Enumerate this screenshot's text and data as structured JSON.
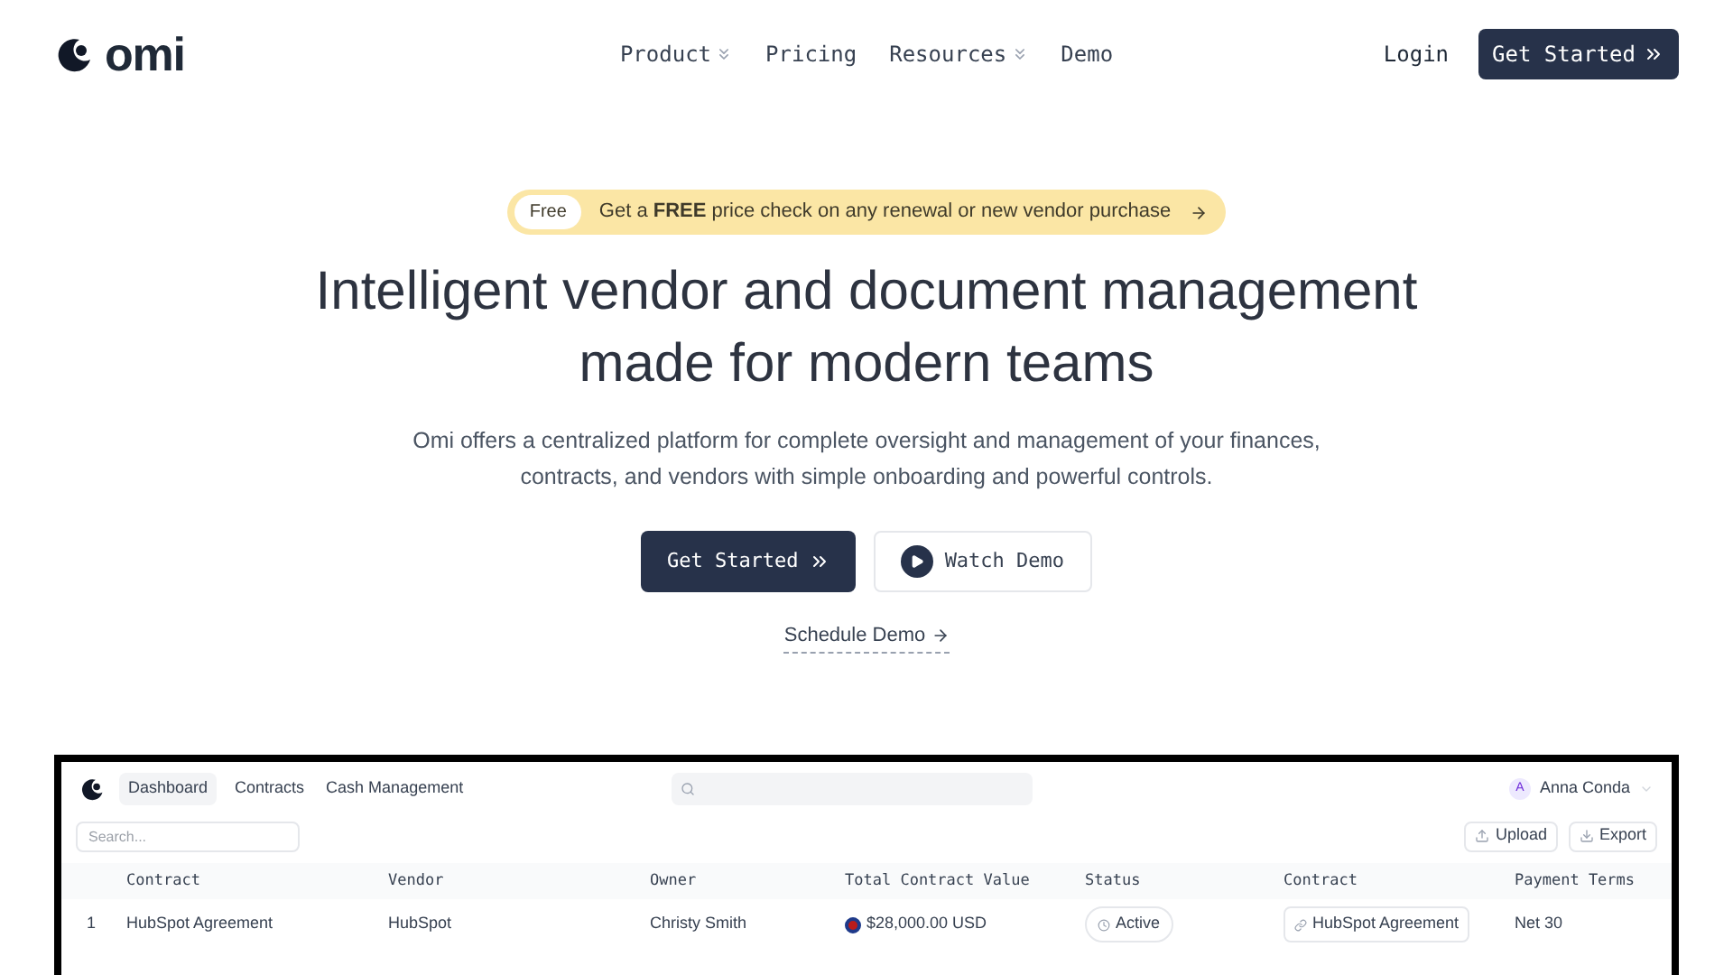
{
  "header": {
    "logo": "omi",
    "nav": [
      {
        "label": "Product",
        "dropdown": true
      },
      {
        "label": "Pricing",
        "dropdown": false
      },
      {
        "label": "Resources",
        "dropdown": true
      },
      {
        "label": "Demo",
        "dropdown": false
      }
    ],
    "login": "Login",
    "cta": "Get Started"
  },
  "hero": {
    "badge": "Free",
    "announcement": "Get a **FREE** price check on any renewal or new vendor purchase",
    "title_lines": [
      "Intelligent vendor and document management",
      "made for modern teams"
    ],
    "subtitle": "Omi offers a centralized platform for complete oversight and management of your finances, contracts, and vendors with simple onboarding and powerful controls.",
    "primary": "Get Started",
    "secondary": "Watch Demo",
    "link": "Schedule Demo"
  },
  "app": {
    "tabs": [
      {
        "label": "Dashboard",
        "selected": true
      },
      {
        "label": "Contracts",
        "selected": false
      },
      {
        "label": "Cash Management",
        "selected": false
      }
    ],
    "user_initial": "A",
    "user_name": "Anna Conda",
    "search_placeholder": "Search...",
    "upload": "Upload",
    "export": "Export",
    "table": {
      "columns": [
        "Contract",
        "Vendor",
        "Owner",
        "Total Contract Value",
        "Status",
        "Contract",
        "Payment Terms"
      ],
      "rows": [
        {
          "index": "1",
          "contract": "HubSpot Agreement",
          "vendor": "HubSpot",
          "owner": "Christy Smith",
          "value": "$28,000.00 USD",
          "status": "Active",
          "document": "HubSpot Agreement",
          "terms": "Net 30"
        }
      ]
    }
  }
}
